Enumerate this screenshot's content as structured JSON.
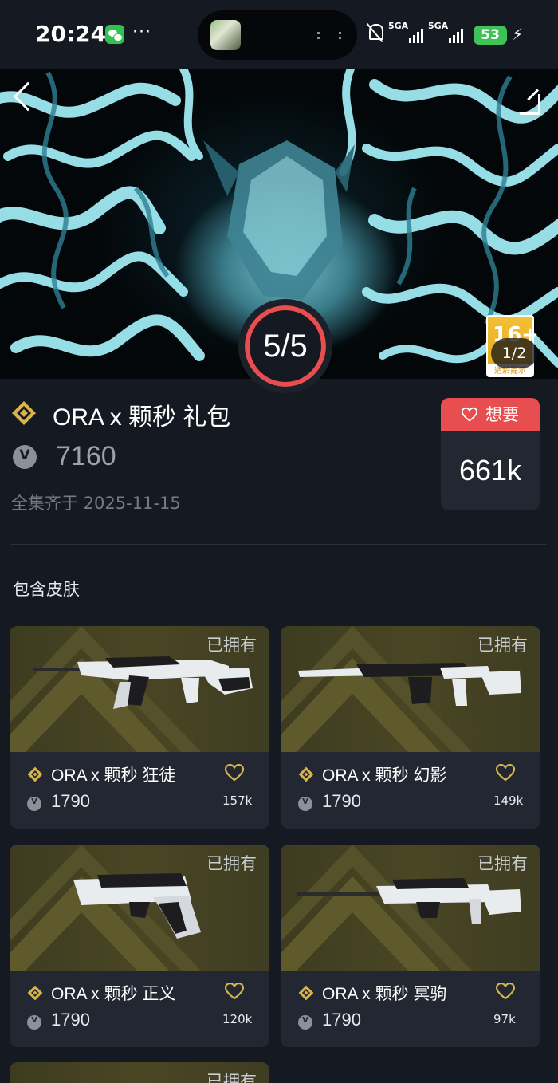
{
  "status_bar": {
    "time": "20:24",
    "dots": "···",
    "signal_1": "5GA",
    "signal_2": "5GA",
    "battery": "53"
  },
  "hero": {
    "counter": "5/5",
    "pager": "1/2",
    "rating_age": "16+",
    "rating_tip": "适龄提示"
  },
  "bundle": {
    "name": "ORA x 颗秒 礼包",
    "price": "7160",
    "complete_date": "全集齐于 2025-11-15",
    "want_label": "想要",
    "want_count": "661k"
  },
  "section_title": "包含皮肤",
  "skins": [
    {
      "owned": "已拥有",
      "name": "ORA x 颗秒 狂徒",
      "price": "1790",
      "likes": "157k"
    },
    {
      "owned": "已拥有",
      "name": "ORA x 颗秒 幻影",
      "price": "1790",
      "likes": "149k"
    },
    {
      "owned": "已拥有",
      "name": "ORA x 颗秒 正义",
      "price": "1790",
      "likes": "120k"
    },
    {
      "owned": "已拥有",
      "name": "ORA x 颗秒 冥驹",
      "price": "1790",
      "likes": "97k"
    },
    {
      "owned": "已拥有"
    }
  ],
  "colors": {
    "accent": "#e84d4f",
    "gold": "#d9b44a",
    "background": "#151922",
    "card": "#222732"
  }
}
